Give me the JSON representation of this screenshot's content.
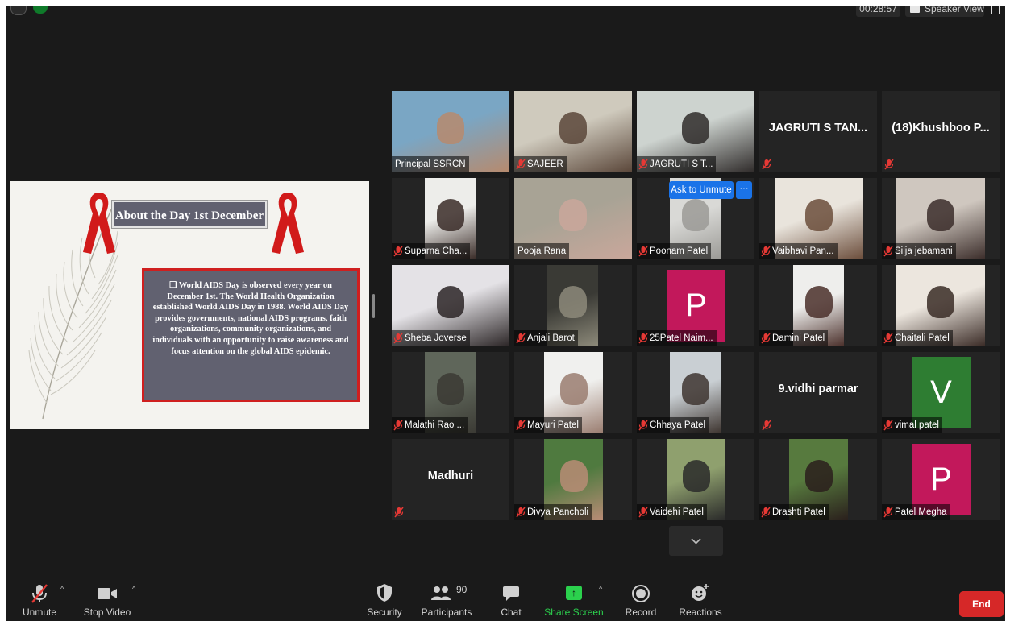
{
  "topbar": {
    "timer": "00:28:57",
    "speaker_view": "Speaker View"
  },
  "slide": {
    "title": "About the Day 1st December",
    "body": "❑ World AIDS Day is observed every year on December 1st. The World Health Organization established World AIDS Day in 1988. World AIDS Day provides governments, national AIDS programs, faith organizations, community organizations, and individuals with an opportunity to raise awareness and focus attention on the global AIDS epidemic."
  },
  "participants_grid": {
    "ask_to_unmute": "Ask to Unmute",
    "more": "···",
    "tiles": [
      {
        "name": "Principal SSRCN",
        "muted": false,
        "kind": "video"
      },
      {
        "name": "SAJEER",
        "muted": true,
        "kind": "video"
      },
      {
        "name": "JAGRUTI S T...",
        "muted": true,
        "kind": "video"
      },
      {
        "big": "JAGRUTI S TAN...",
        "name": "",
        "muted": true,
        "kind": "noncam"
      },
      {
        "big": "(18)Khushboo P...",
        "name": "",
        "muted": true,
        "kind": "noncam"
      },
      {
        "name": "Suparna Cha...",
        "muted": true,
        "kind": "video"
      },
      {
        "name": "Pooja Rana",
        "muted": false,
        "kind": "video",
        "active": true
      },
      {
        "name": "Poonam Patel",
        "muted": true,
        "kind": "video"
      },
      {
        "name": "Vaibhavi Pan...",
        "muted": true,
        "kind": "video"
      },
      {
        "name": "Silja jebamani",
        "muted": true,
        "kind": "video"
      },
      {
        "name": "Sheba Joverse",
        "muted": true,
        "kind": "video"
      },
      {
        "name": "Anjali Barot",
        "muted": true,
        "kind": "video"
      },
      {
        "name": "25Patel Naim...",
        "muted": true,
        "kind": "avatar",
        "letter": "P",
        "color": "#c2185b"
      },
      {
        "name": "Damini Patel",
        "muted": true,
        "kind": "video"
      },
      {
        "name": "Chaitali Patel",
        "muted": true,
        "kind": "video"
      },
      {
        "name": "Malathi Rao ...",
        "muted": true,
        "kind": "video"
      },
      {
        "name": "Mayuri Patel",
        "muted": true,
        "kind": "video"
      },
      {
        "name": "Chhaya Patel",
        "muted": true,
        "kind": "video"
      },
      {
        "big": "9.vidhi parmar",
        "name": "",
        "muted": true,
        "kind": "noncam"
      },
      {
        "name": "vimal patel",
        "muted": true,
        "kind": "avatar",
        "letter": "V",
        "color": "#2e7d32"
      },
      {
        "big": "Madhuri",
        "name": "",
        "muted": true,
        "kind": "noncam"
      },
      {
        "name": "Divya Pancholi",
        "muted": true,
        "kind": "video"
      },
      {
        "name": "Vaidehi Patel",
        "muted": true,
        "kind": "video"
      },
      {
        "name": "Drashti Patel",
        "muted": true,
        "kind": "video"
      },
      {
        "name": "Patel Megha",
        "muted": true,
        "kind": "avatar",
        "letter": "P",
        "color": "#c2185b"
      }
    ]
  },
  "toolbar": {
    "unmute": "Unmute",
    "stop_video": "Stop Video",
    "security": "Security",
    "participants": "Participants",
    "participants_count": "90",
    "chat": "Chat",
    "share_screen": "Share Screen",
    "record": "Record",
    "reactions": "Reactions",
    "end": "End",
    "caret": "^",
    "share_arrow": "↑"
  },
  "colors": {
    "share_green": "#2bd14d",
    "end_red": "#d62828",
    "ask_blue": "#1a73e8",
    "active_border": "#d9e86b"
  }
}
